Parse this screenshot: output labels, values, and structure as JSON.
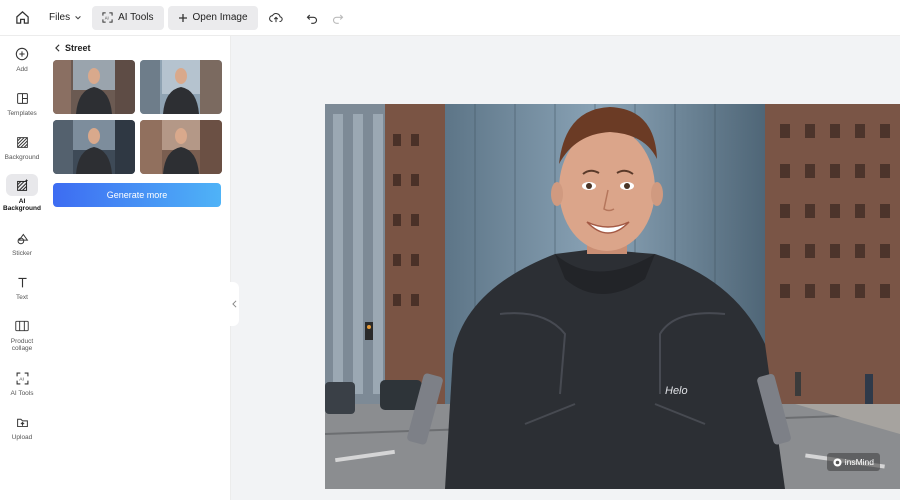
{
  "topbar": {
    "files_label": "Files",
    "ai_tools_label": "AI Tools",
    "open_image_label": "Open Image"
  },
  "rail": {
    "items": [
      {
        "label": "Add",
        "icon": "plus-circle-icon"
      },
      {
        "label": "Templates",
        "icon": "templates-icon"
      },
      {
        "label": "Background",
        "icon": "background-icon"
      },
      {
        "label": "AI Background",
        "icon": "ai-background-icon"
      },
      {
        "label": "Sticker",
        "icon": "sticker-icon"
      },
      {
        "label": "Text",
        "icon": "text-icon"
      },
      {
        "label": "Product collage",
        "icon": "collage-icon"
      },
      {
        "label": "AI Tools",
        "icon": "ai-tools-icon"
      },
      {
        "label": "Upload",
        "icon": "upload-icon"
      }
    ]
  },
  "panel": {
    "title": "Street",
    "generate_label": "Generate more"
  },
  "canvas": {
    "watermark": "insMind"
  },
  "colors": {
    "accent_start": "#3d6cf2",
    "accent_end": "#4fb3f7"
  }
}
